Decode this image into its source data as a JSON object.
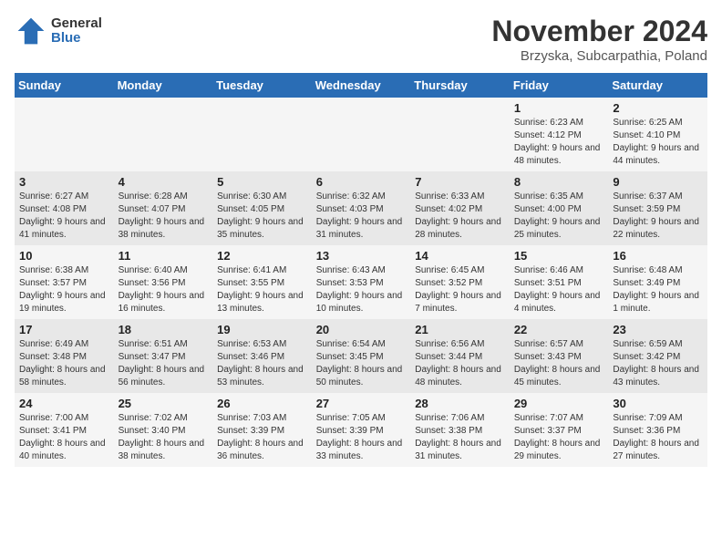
{
  "logo": {
    "general": "General",
    "blue": "Blue"
  },
  "title": "November 2024",
  "subtitle": "Brzyska, Subcarpathia, Poland",
  "days_header": [
    "Sunday",
    "Monday",
    "Tuesday",
    "Wednesday",
    "Thursday",
    "Friday",
    "Saturday"
  ],
  "weeks": [
    [
      {
        "day": "",
        "info": ""
      },
      {
        "day": "",
        "info": ""
      },
      {
        "day": "",
        "info": ""
      },
      {
        "day": "",
        "info": ""
      },
      {
        "day": "",
        "info": ""
      },
      {
        "day": "1",
        "info": "Sunrise: 6:23 AM\nSunset: 4:12 PM\nDaylight: 9 hours and 48 minutes."
      },
      {
        "day": "2",
        "info": "Sunrise: 6:25 AM\nSunset: 4:10 PM\nDaylight: 9 hours and 44 minutes."
      }
    ],
    [
      {
        "day": "3",
        "info": "Sunrise: 6:27 AM\nSunset: 4:08 PM\nDaylight: 9 hours and 41 minutes."
      },
      {
        "day": "4",
        "info": "Sunrise: 6:28 AM\nSunset: 4:07 PM\nDaylight: 9 hours and 38 minutes."
      },
      {
        "day": "5",
        "info": "Sunrise: 6:30 AM\nSunset: 4:05 PM\nDaylight: 9 hours and 35 minutes."
      },
      {
        "day": "6",
        "info": "Sunrise: 6:32 AM\nSunset: 4:03 PM\nDaylight: 9 hours and 31 minutes."
      },
      {
        "day": "7",
        "info": "Sunrise: 6:33 AM\nSunset: 4:02 PM\nDaylight: 9 hours and 28 minutes."
      },
      {
        "day": "8",
        "info": "Sunrise: 6:35 AM\nSunset: 4:00 PM\nDaylight: 9 hours and 25 minutes."
      },
      {
        "day": "9",
        "info": "Sunrise: 6:37 AM\nSunset: 3:59 PM\nDaylight: 9 hours and 22 minutes."
      }
    ],
    [
      {
        "day": "10",
        "info": "Sunrise: 6:38 AM\nSunset: 3:57 PM\nDaylight: 9 hours and 19 minutes."
      },
      {
        "day": "11",
        "info": "Sunrise: 6:40 AM\nSunset: 3:56 PM\nDaylight: 9 hours and 16 minutes."
      },
      {
        "day": "12",
        "info": "Sunrise: 6:41 AM\nSunset: 3:55 PM\nDaylight: 9 hours and 13 minutes."
      },
      {
        "day": "13",
        "info": "Sunrise: 6:43 AM\nSunset: 3:53 PM\nDaylight: 9 hours and 10 minutes."
      },
      {
        "day": "14",
        "info": "Sunrise: 6:45 AM\nSunset: 3:52 PM\nDaylight: 9 hours and 7 minutes."
      },
      {
        "day": "15",
        "info": "Sunrise: 6:46 AM\nSunset: 3:51 PM\nDaylight: 9 hours and 4 minutes."
      },
      {
        "day": "16",
        "info": "Sunrise: 6:48 AM\nSunset: 3:49 PM\nDaylight: 9 hours and 1 minute."
      }
    ],
    [
      {
        "day": "17",
        "info": "Sunrise: 6:49 AM\nSunset: 3:48 PM\nDaylight: 8 hours and 58 minutes."
      },
      {
        "day": "18",
        "info": "Sunrise: 6:51 AM\nSunset: 3:47 PM\nDaylight: 8 hours and 56 minutes."
      },
      {
        "day": "19",
        "info": "Sunrise: 6:53 AM\nSunset: 3:46 PM\nDaylight: 8 hours and 53 minutes."
      },
      {
        "day": "20",
        "info": "Sunrise: 6:54 AM\nSunset: 3:45 PM\nDaylight: 8 hours and 50 minutes."
      },
      {
        "day": "21",
        "info": "Sunrise: 6:56 AM\nSunset: 3:44 PM\nDaylight: 8 hours and 48 minutes."
      },
      {
        "day": "22",
        "info": "Sunrise: 6:57 AM\nSunset: 3:43 PM\nDaylight: 8 hours and 45 minutes."
      },
      {
        "day": "23",
        "info": "Sunrise: 6:59 AM\nSunset: 3:42 PM\nDaylight: 8 hours and 43 minutes."
      }
    ],
    [
      {
        "day": "24",
        "info": "Sunrise: 7:00 AM\nSunset: 3:41 PM\nDaylight: 8 hours and 40 minutes."
      },
      {
        "day": "25",
        "info": "Sunrise: 7:02 AM\nSunset: 3:40 PM\nDaylight: 8 hours and 38 minutes."
      },
      {
        "day": "26",
        "info": "Sunrise: 7:03 AM\nSunset: 3:39 PM\nDaylight: 8 hours and 36 minutes."
      },
      {
        "day": "27",
        "info": "Sunrise: 7:05 AM\nSunset: 3:39 PM\nDaylight: 8 hours and 33 minutes."
      },
      {
        "day": "28",
        "info": "Sunrise: 7:06 AM\nSunset: 3:38 PM\nDaylight: 8 hours and 31 minutes."
      },
      {
        "day": "29",
        "info": "Sunrise: 7:07 AM\nSunset: 3:37 PM\nDaylight: 8 hours and 29 minutes."
      },
      {
        "day": "30",
        "info": "Sunrise: 7:09 AM\nSunset: 3:36 PM\nDaylight: 8 hours and 27 minutes."
      }
    ]
  ]
}
